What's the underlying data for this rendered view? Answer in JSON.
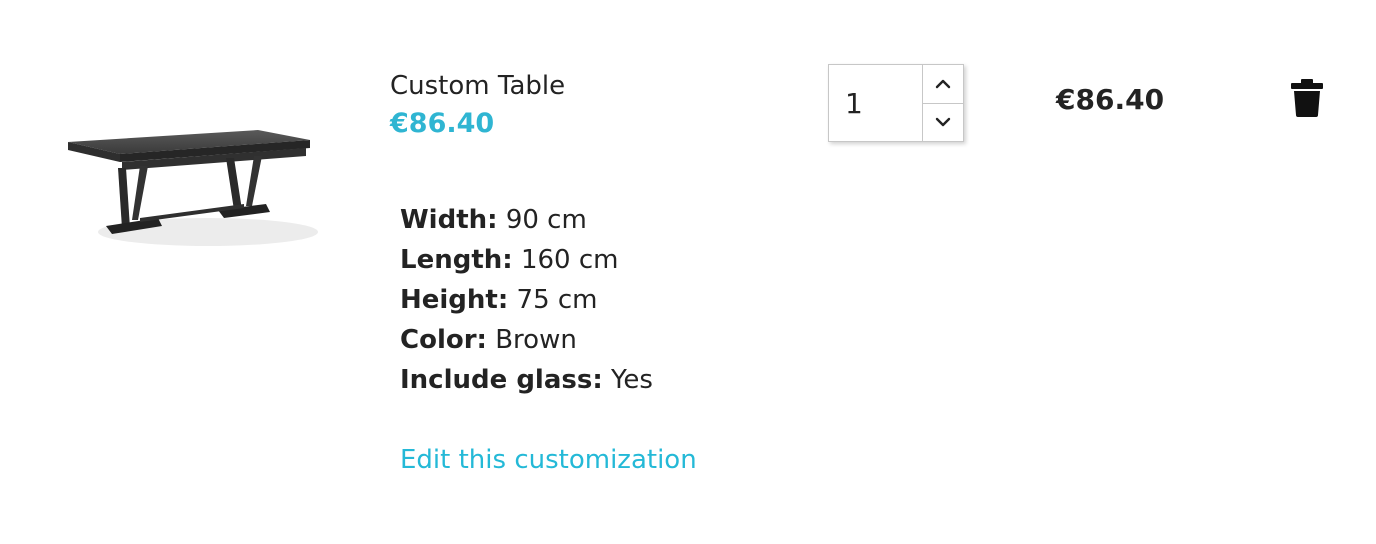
{
  "product": {
    "name": "Custom Table",
    "unit_price": "€86.40",
    "image_icon": "table-product-image"
  },
  "customization": {
    "attributes": [
      {
        "name": "Width:",
        "value": "90 cm"
      },
      {
        "name": "Length:",
        "value": "160 cm"
      },
      {
        "name": "Height:",
        "value": "75 cm"
      },
      {
        "name": "Color:",
        "value": "Brown"
      },
      {
        "name": "Include glass:",
        "value": "Yes"
      }
    ],
    "edit_link": "Edit this customization"
  },
  "quantity": {
    "value": "1",
    "up_icon": "chevron-up-icon",
    "down_icon": "chevron-down-icon"
  },
  "line_total": "€86.40",
  "delete_icon": "trash-icon",
  "colors": {
    "accent": "#2fb5d2",
    "link": "#24b9d7",
    "text": "#232323"
  }
}
